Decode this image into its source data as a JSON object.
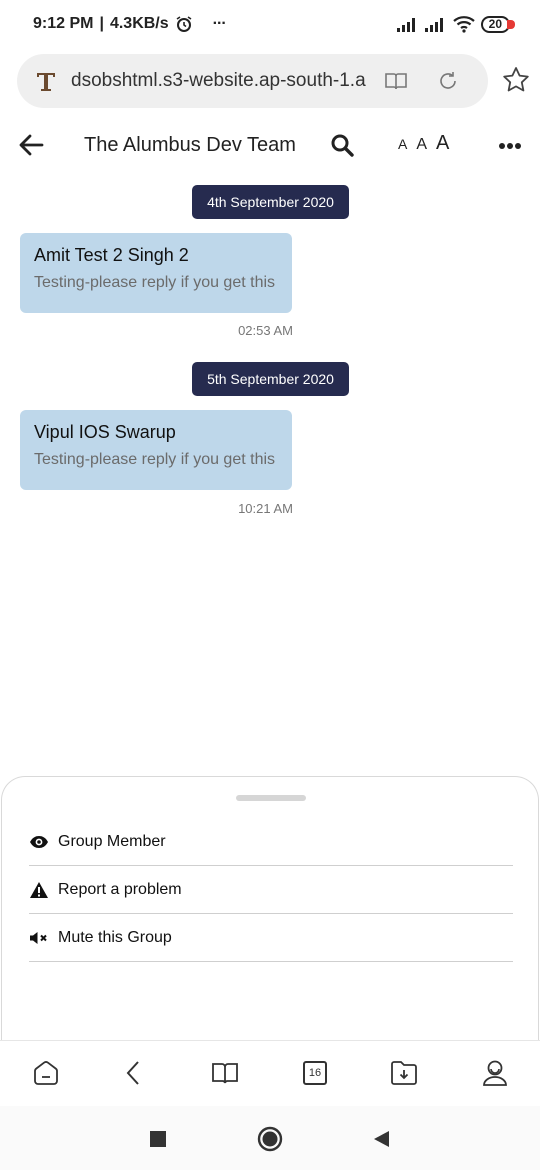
{
  "status_bar": {
    "time": "9:12 PM",
    "speed": "4.3KB/s",
    "more": "···",
    "battery": "20"
  },
  "browser": {
    "url": "dsobshtml.s3-website.ap-south-1.a"
  },
  "header": {
    "title": "The Alumbus Dev Team",
    "font_sizes": [
      "A",
      "A",
      "A"
    ]
  },
  "messages": [
    {
      "date": "4th September 2020",
      "sender": "Amit Test 2 Singh 2",
      "text": "Testing-please reply if you get this",
      "time": "02:53 AM"
    },
    {
      "date": "5th September 2020",
      "sender": "Vipul IOS Swarup",
      "text": "Testing-please reply if you get this",
      "time": "10:21 AM"
    }
  ],
  "sheet": {
    "items": [
      {
        "label": "Group Member",
        "icon": "eye-icon"
      },
      {
        "label": "Report a problem",
        "icon": "warning-icon"
      },
      {
        "label": "Mute this Group",
        "icon": "mute-icon"
      }
    ]
  },
  "bottom_nav": {
    "tabs_count": "16",
    "icons": [
      "home-icon",
      "back-chevron-icon",
      "bookmarks-icon",
      "tabs-icon",
      "downloads-icon",
      "profile-icon"
    ]
  },
  "colors": {
    "date_chip": "#262b4f",
    "bubble": "#bed7ea",
    "battery_low": "#e53935"
  }
}
